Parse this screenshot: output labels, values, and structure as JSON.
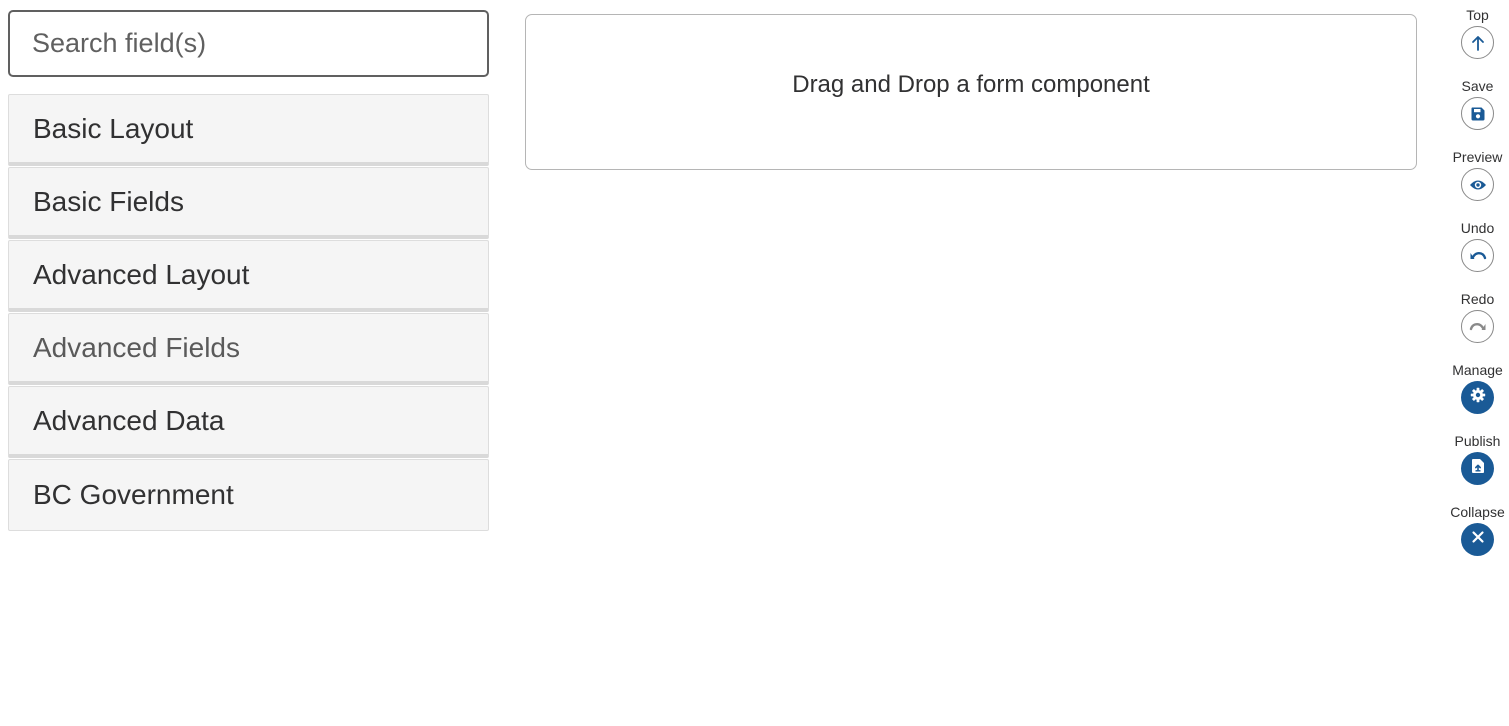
{
  "search": {
    "placeholder": "Search field(s)"
  },
  "groups": [
    {
      "label": "Basic Layout"
    },
    {
      "label": "Basic Fields"
    },
    {
      "label": "Advanced Layout"
    },
    {
      "label": "Advanced Fields"
    },
    {
      "label": "Advanced Data"
    },
    {
      "label": "BC Government"
    }
  ],
  "dropzone": {
    "text": "Drag and Drop a form component"
  },
  "actions": [
    {
      "label": "Top",
      "icon": "arrow-up-icon"
    },
    {
      "label": "Save",
      "icon": "save-icon"
    },
    {
      "label": "Preview",
      "icon": "eye-icon"
    },
    {
      "label": "Undo",
      "icon": "undo-icon"
    },
    {
      "label": "Redo",
      "icon": "redo-icon"
    },
    {
      "label": "Manage",
      "icon": "gear-icon"
    },
    {
      "label": "Publish",
      "icon": "publish-file-icon"
    },
    {
      "label": "Collapse",
      "icon": "close-icon"
    }
  ],
  "colors": {
    "primary": "#1a5a96",
    "outline": "#8a8a8a"
  }
}
